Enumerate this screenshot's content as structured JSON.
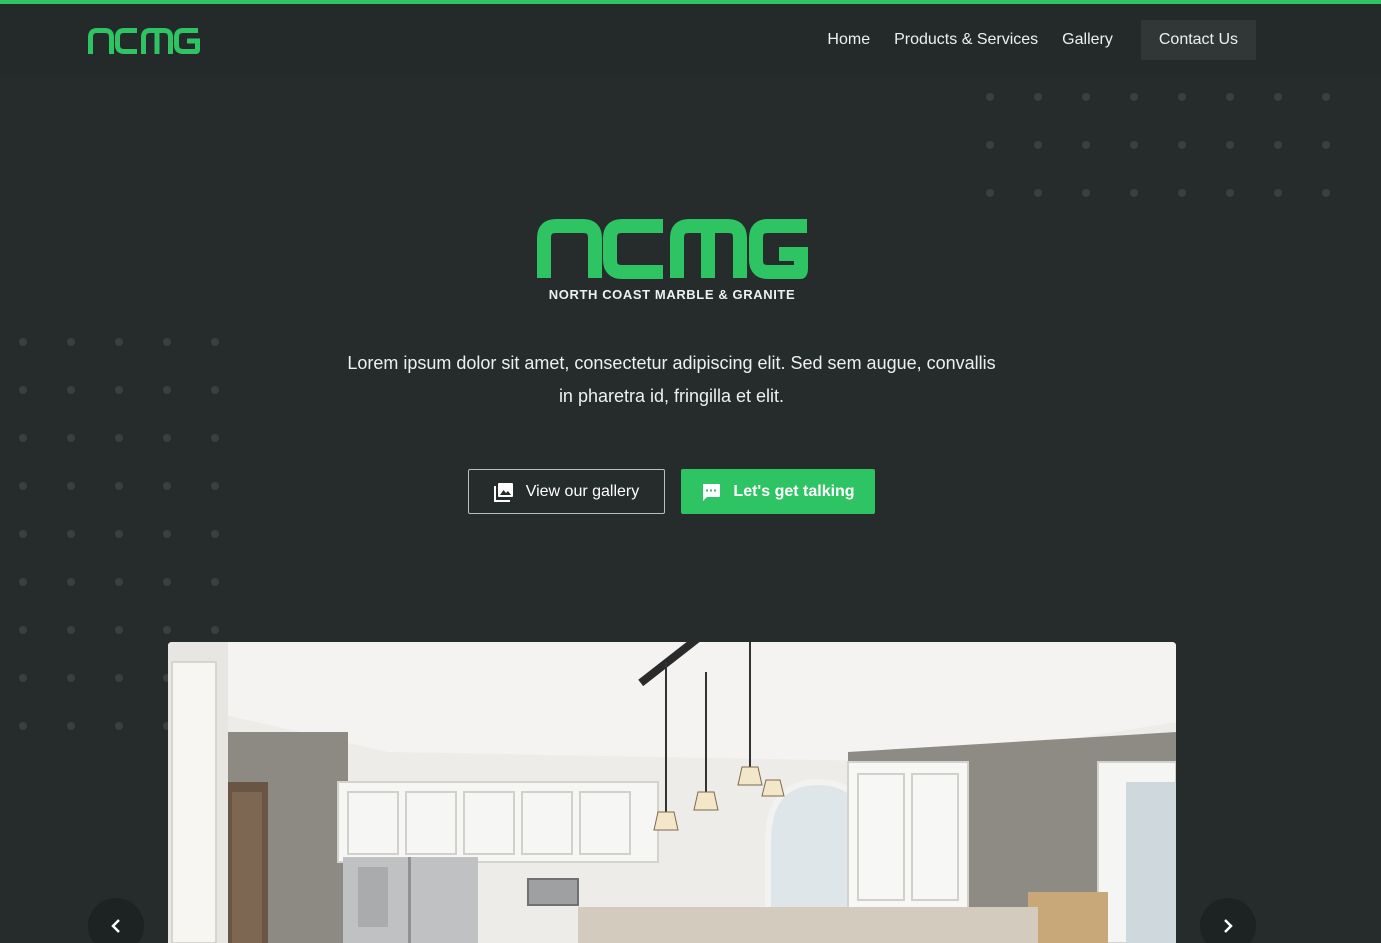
{
  "brand": {
    "logo_text": "ncmg",
    "full_name": "NORTH COAST MARBLE & GRANITE",
    "accent_color": "#2fc463",
    "background_color": "#262b2b"
  },
  "nav": {
    "links": [
      "Home",
      "Products & Services",
      "Gallery"
    ],
    "contact_label": "Contact Us"
  },
  "hero": {
    "description": "Lorem ipsum dolor sit amet, consectetur adipiscing elit. Sed sem augue, convallis in pharetra id, fringilla et elit.",
    "gallery_button": "View our gallery",
    "gallery_icon": "image-gallery-icon",
    "talk_button": "Let's get talking",
    "talk_icon": "chat-bubble-icon"
  },
  "carousel": {
    "prev_icon": "chevron-left-icon",
    "next_icon": "chevron-right-icon",
    "image_subject": "white kitchen interior with pendant lights"
  }
}
